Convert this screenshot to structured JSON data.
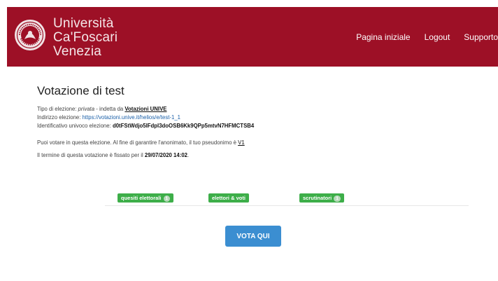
{
  "header": {
    "university_lines": [
      "Università",
      "Ca'Foscari",
      "Venezia"
    ],
    "nav": [
      "Pagina iniziale",
      "Logout",
      "Supporto"
    ],
    "colors": {
      "brand": "#9d1026"
    }
  },
  "election": {
    "title": "Votazione di test",
    "type_prefix": "Tipo di elezione: ",
    "type_value": "privata",
    "type_mid": " - indetta da ",
    "owner": "Votazioni UNIVE",
    "url_label": "Indirizzo elezione: ",
    "url": "https://votazioni.unive.it/helios/e/test-1_1",
    "id_label": "Identificativo univoco elezione: ",
    "id_value": "d0tFStWdjo5lFdpl3doOSB6Kk9QPp5mtvN7HFMCTSB4",
    "eligibility_text": "Puoi votare in questa elezione. Al fine di garantire l'anonimato, il tuo pseudonimo è ",
    "pseudonym": "V1",
    "deadline_prefix": "Il termine di questa votazione è fissato per il ",
    "deadline": "29/07/2020 14:02",
    "deadline_suffix": "."
  },
  "tabs": [
    {
      "label": "quesiti elettorali",
      "badge": "1"
    },
    {
      "label": "elettori & voti",
      "badge": ""
    },
    {
      "label": "scrutinatori",
      "badge": "1"
    }
  ],
  "vote_button": {
    "label": "VOTA QUI",
    "color": "#3b8ed1"
  },
  "tab_color": "#3dae49"
}
